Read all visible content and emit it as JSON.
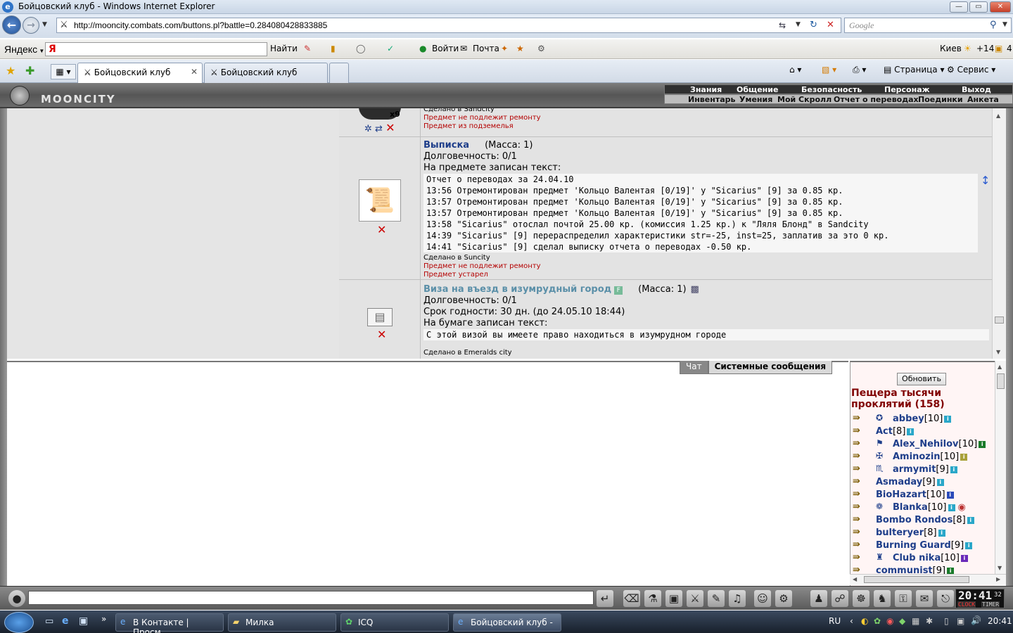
{
  "window": {
    "title": "Бойцовский клуб - Windows Internet Explorer",
    "min_label": "—",
    "max_label": "▭",
    "close_label": "✕"
  },
  "address": {
    "url": "http://mooncity.combats.com/buttons.pl?battle=0.284080428833885",
    "search_placeholder": "Google"
  },
  "yandex": {
    "logo": "Яндекс",
    "find_label": "Найти",
    "login_label": "Войти",
    "mail_label": "Почта",
    "city": "Киев",
    "temp": "+14",
    "count": "4"
  },
  "tabs": [
    {
      "label": "Бойцовский клуб",
      "active": true
    },
    {
      "label": "Бойцовский клуб",
      "active": false
    }
  ],
  "commands": {
    "page_label": "Страница",
    "service_label": "Сервис"
  },
  "game": {
    "title": "MOONCITY",
    "menu_top": [
      "Знания",
      "Общение",
      "Безопасность",
      "Персонаж",
      "Выход"
    ],
    "menu_bottom": [
      "Инвентарь",
      "Умения",
      "Мой Скролл",
      "Отчет о переводах",
      "Поединки",
      "Анкета"
    ]
  },
  "items": {
    "prev_item": {
      "partial_text": "Сделано в Sandcity",
      "qty": "x9",
      "not_repairable": "Предмет не подлежит ремонту",
      "dungeon": "Предмет из подземелья"
    },
    "statement": {
      "name": "Выписка",
      "mass": "(Масса: 1)",
      "durability": "Долговечность: 0/1",
      "text_label": "На предмете записан текст:",
      "lines": [
        "Отчет о переводах за 24.04.10",
        "13:56 Отремонтирован предмет 'Кольцо Валентая [0/19]' у \"Sicarius\" [9] за 0.85 кр.",
        "13:57 Отремонтирован предмет 'Кольцо Валентая [0/19]' у \"Sicarius\" [9] за 0.85 кр.",
        "13:57 Отремонтирован предмет 'Кольцо Валентая [0/19]' у \"Sicarius\" [9] за 0.85 кр.",
        "13:58 \"Sicarius\" отослал почтой 25.00 кр. (комиссия 1.25 кр.) к \"Ляля Блонд\" в Sandcity",
        "14:39 \"Sicarius\" [9] перераспределил характеристики str=-25, inst=25, заплатив за это 0 кр.",
        "14:41 \"Sicarius\" [9] сделал выписку отчета о переводах -0.50 кр."
      ],
      "made_in": "Сделано в Suncity",
      "not_repairable": "Предмет не подлежит ремонту",
      "outdated": "Предмет устарел"
    },
    "visa": {
      "name": "Виза на въезд в изумрудный город",
      "mass": "(Масса: 1)",
      "durability": "Долговечность: 0/1",
      "validity": "Срок годности: 30 дн. (до 24.05.10 18:44)",
      "text_label": "На бумаге записан текст:",
      "text": "С этой визой вы имеете право находиться в изумрудном городе",
      "made_in": "Сделано в Emeralds city"
    }
  },
  "chat": {
    "tab_chat": "Чат",
    "tab_system": "Системные сообщения"
  },
  "online": {
    "refresh_label": "Обновить",
    "location": "Пещера тысячи проклятий (158)",
    "players": [
      {
        "name": "abbey",
        "level": "[10]"
      },
      {
        "name": "Act",
        "level": "[8]"
      },
      {
        "name": "Alex_Nehilov",
        "level": "[10]"
      },
      {
        "name": "Aminozin",
        "level": "[10]"
      },
      {
        "name": "armymit",
        "level": "[9]"
      },
      {
        "name": "Asmaday",
        "level": "[9]"
      },
      {
        "name": "BioHazart",
        "level": "[10]"
      },
      {
        "name": "Blanka",
        "level": "[10]"
      },
      {
        "name": "Bombo Rondos",
        "level": "[8]"
      },
      {
        "name": "bulteryer",
        "level": "[8]"
      },
      {
        "name": "Burning Guard",
        "level": "[9]"
      },
      {
        "name": "Club nika",
        "level": "[10]"
      },
      {
        "name": "communist",
        "level": "[9]"
      }
    ]
  },
  "clock": {
    "time": "20:41",
    "seconds": "32",
    "clock_label": "CLOCK",
    "timer_label": "TIMER"
  },
  "taskbar": {
    "tasks": [
      "В Контакте | Просм...",
      "Милка",
      "ICQ",
      "Бойцовский клуб - ..."
    ],
    "lang": "RU",
    "time": "20:41"
  }
}
